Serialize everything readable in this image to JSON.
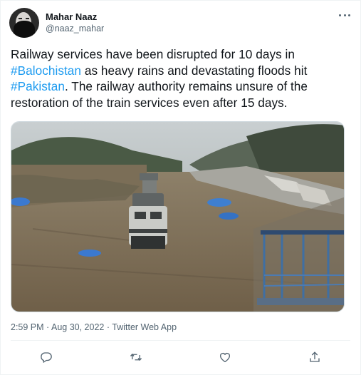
{
  "author": {
    "display_name": "Mahar Naaz",
    "handle": "@naaz_mahar"
  },
  "tweet": {
    "segments": [
      {
        "text": "Railway services have been disrupted for 10 days in ",
        "kind": "plain"
      },
      {
        "text": "#Balochistan",
        "kind": "hashtag"
      },
      {
        "text": " as heavy rains and devastating floods hit ",
        "kind": "plain"
      },
      {
        "text": "#Pakistan",
        "kind": "hashtag"
      },
      {
        "text": ". The railway authority remains unsure of the restoration of the train services even after 15 days.",
        "kind": "plain"
      }
    ]
  },
  "meta": {
    "time": "2:59 PM",
    "separator1": " · ",
    "date": "Aug 30, 2022",
    "separator2": " · ",
    "source": "Twitter Web App"
  },
  "icons": {
    "more": "more-icon",
    "reply": "reply-icon",
    "retweet": "retweet-icon",
    "like": "like-icon",
    "share": "share-icon"
  },
  "colors": {
    "accent": "#1d9bf0",
    "text": "#0f1419",
    "secondary": "#536471"
  }
}
